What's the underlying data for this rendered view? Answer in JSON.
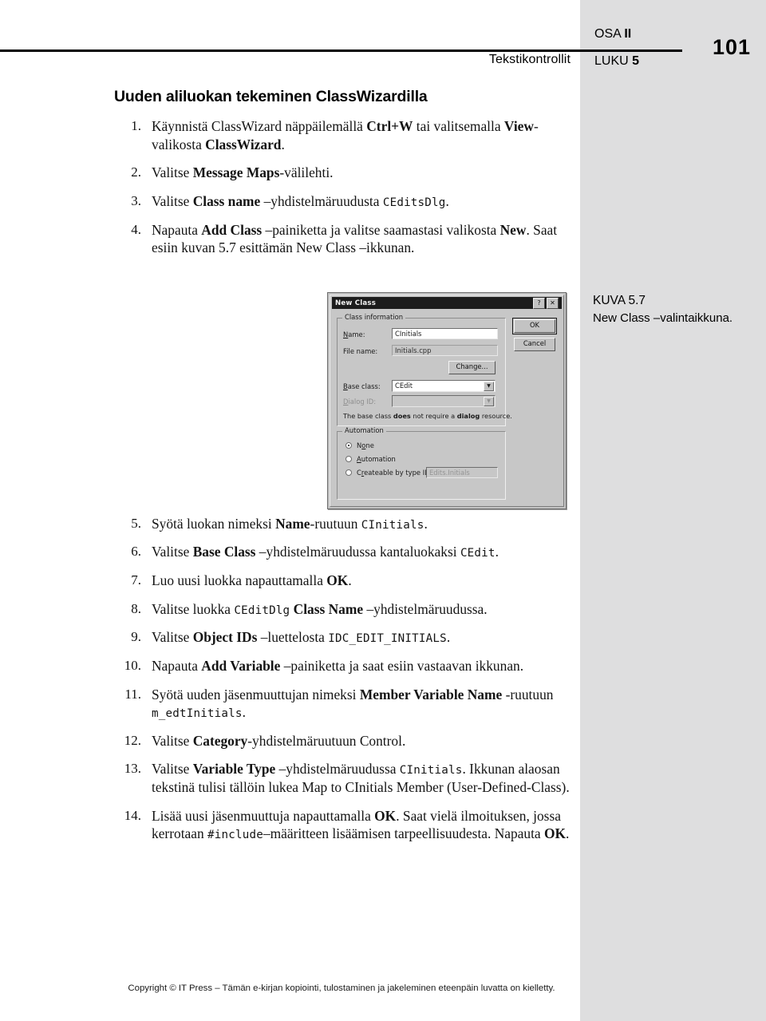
{
  "header": {
    "running_head": "Tekstikontrollit",
    "part_label": "OSA",
    "part_number": "II",
    "chapter_label": "LUKU",
    "chapter_number": "5",
    "page_number": "101"
  },
  "section": {
    "title": "Uuden aliluokan tekeminen ClassWizardilla"
  },
  "steps": [
    {
      "num": "1.",
      "html": "Käynnistä ClassWizard näppäilemällä <b>Ctrl+W</b> tai valitsemalla <b>View</b>-valikosta <b>ClassWizard</b>."
    },
    {
      "num": "2.",
      "html": "Valitse <b>Message Maps</b>-välilehti."
    },
    {
      "num": "3.",
      "html": "Valitse <b>Class name</b> –yhdistelmäruudusta <span class=\"mono\">CEditsDlg</span>."
    },
    {
      "num": "4.",
      "html": "Napauta <b>Add Class</b> –painiketta ja valitse saamastasi valikosta <b>New</b>. Saat esiin kuvan 5.7 esittämän New Class –ikkunan."
    },
    {
      "num": "5.",
      "html": "Syötä luokan nimeksi <b>Name</b>-ruutuun <span class=\"mono\">CInitials</span>."
    },
    {
      "num": "6.",
      "html": "Valitse <b>Base Class</b> –yhdistelmäruudussa kantaluokaksi <span class=\"mono\">CEdit</span>."
    },
    {
      "num": "7.",
      "html": "Luo uusi luokka napauttamalla <b>OK</b>."
    },
    {
      "num": "8.",
      "html": "Valitse luokka <span class=\"mono\">CEditDlg</span> <b>Class Name</b> –yhdistelmäruudussa."
    },
    {
      "num": "9.",
      "html": "Valitse <b>Object IDs</b> –luettelosta <span class=\"mono\">IDC_EDIT_INITIALS</span>."
    },
    {
      "num": "10.",
      "html": "Napauta <b>Add Variable</b> –painiketta ja saat esiin vastaavan ikkunan."
    },
    {
      "num": "11.",
      "html": "Syötä uuden jäsenmuuttujan nimeksi <b>Member Variable Name</b> -ruutuun <span class=\"mono\">m_edtInitials</span>."
    },
    {
      "num": "12.",
      "html": "Valitse <b>Category</b>-yhdistelmäruutuun Control."
    },
    {
      "num": "13.",
      "html": "Valitse <b>Variable Type</b> –yhdistelmäruudussa <span class=\"mono\">CInitials</span>. Ikkunan alaosan tekstinä tulisi tällöin lukea Map to CInitials Member (User-Defined-Class)."
    },
    {
      "num": "14.",
      "html": "Lisää uusi jäsenmuuttuja napauttamalla <b>OK</b>. Saat vielä ilmoituksen, jossa kerrotaan <span class=\"mono\">#include</span>–määritteen lisäämisen tarpeellisuudesta. Napauta <b>OK</b>."
    }
  ],
  "figure": {
    "caption_label": "KUVA 5.7",
    "caption_text": "New Class –valintaikkuna."
  },
  "dialog": {
    "title": "New Class",
    "help_button": "?",
    "close_button": "✕",
    "group_class_information": "Class information",
    "label_name": "Name:",
    "value_name": "CInitials",
    "label_file_name": "File name:",
    "value_file_name": "Initials.cpp",
    "button_change": "Change...",
    "label_base_class": "Base class:",
    "value_base_class": "CEdit",
    "label_dialog_id": "Dialog ID:",
    "value_dialog_id": "",
    "help_text_1": "The base class ",
    "help_text_2": "does",
    "help_text_3": " not require a ",
    "help_text_4": "dialog",
    "help_text_5": " resource.",
    "group_automation": "Automation",
    "radio_none": "None",
    "radio_automation": "Automation",
    "radio_createable": "Createable by type ID:",
    "value_type_id": "Edits.Initials",
    "button_ok": "OK",
    "button_cancel": "Cancel"
  },
  "footer": {
    "copyright": "Copyright © IT Press – Tämän e-kirjan kopiointi, tulostaminen ja jakeleminen eteenpäin luvatta on kielletty."
  },
  "colors": {
    "gray_band": "#dededf",
    "dialog_face": "#c7c7c7",
    "titlebar": "#1c1c1c"
  }
}
